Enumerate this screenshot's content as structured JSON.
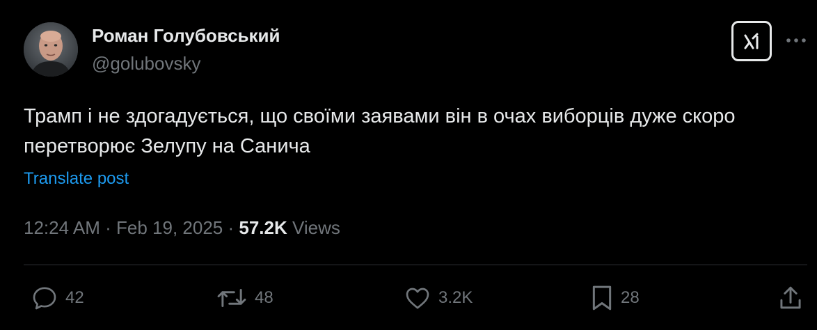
{
  "author": {
    "display_name": "Роман Голубовський",
    "handle": "@golubovsky"
  },
  "tweet": {
    "text": "Трамп і не здогадується, що своїми заявами він в очах виборців дуже скоро перетворює Зелупу на Санича",
    "translate_label": "Translate post",
    "time": "12:24 AM",
    "date": "Feb 19, 2025",
    "separator": "·",
    "views_count": "57.2K",
    "views_label": "Views"
  },
  "actions": {
    "replies": "42",
    "reposts": "48",
    "likes": "3.2K",
    "bookmarks": "28"
  },
  "icons": {
    "avatar": "profile-photo",
    "grok": "grok-icon",
    "more": "more-dots-icon",
    "reply": "reply-icon",
    "repost": "repost-icon",
    "like": "heart-icon",
    "bookmark": "bookmark-icon",
    "share": "share-icon"
  },
  "colors": {
    "background": "#000000",
    "text": "#e7e9ea",
    "secondary": "#71767b",
    "link": "#1d9bf0",
    "divider": "#2f3336"
  }
}
